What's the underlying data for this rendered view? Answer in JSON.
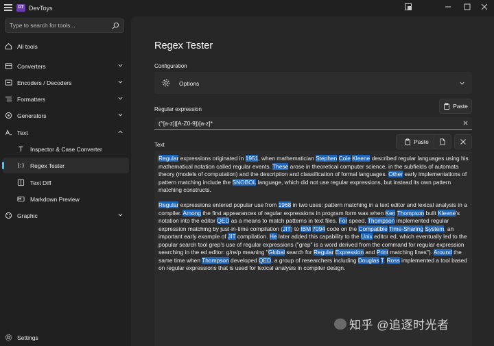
{
  "window": {
    "title": "DevToys",
    "logo": "DevToys"
  },
  "search": {
    "placeholder": "Type to search for tools..."
  },
  "sidebar": {
    "all_tools": "All tools",
    "groups": [
      {
        "label": "Converters",
        "icon": "converters-icon"
      },
      {
        "label": "Encoders / Decoders",
        "icon": "encoders-icon"
      },
      {
        "label": "Formatters",
        "icon": "formatters-icon"
      },
      {
        "label": "Generators",
        "icon": "generators-icon"
      },
      {
        "label": "Text",
        "icon": "text-icon"
      },
      {
        "label": "Graphic",
        "icon": "graphic-icon"
      }
    ],
    "text_items": [
      {
        "label": "Inspector & Case Converter",
        "icon": "inspector-icon"
      },
      {
        "label": "Regex Tester",
        "icon": "regex-icon",
        "selected": true
      },
      {
        "label": "Text Diff",
        "icon": "text-diff-icon"
      },
      {
        "label": "Markdown Preview",
        "icon": "markdown-icon"
      }
    ],
    "settings": "Settings"
  },
  "main": {
    "title": "Regex Tester",
    "configuration_label": "Configuration",
    "options_label": "Options",
    "regex_label": "Regular expression",
    "paste_label": "Paste",
    "regex_value": "(^[a-z]|[A-Z0-9])[a-z]*",
    "text_label": "Text",
    "text_paste_label": "Paste"
  },
  "text_content": {
    "paragraphs": [
      [
        {
          "t": "Regular",
          "h": true
        },
        {
          "t": " expressions originated in "
        },
        {
          "t": "1951",
          "h": true
        },
        {
          "t": ", when mathematician "
        },
        {
          "t": "Stephen",
          "h": true
        },
        {
          "t": " "
        },
        {
          "t": "Cole",
          "h": true
        },
        {
          "t": " "
        },
        {
          "t": "Kleene",
          "h": true
        },
        {
          "t": " described regular languages using his mathematical notation called regular events. "
        },
        {
          "t": "These",
          "h": true
        },
        {
          "t": " arose in theoretical computer science, in the subfields of automata theory (models of computation) and the description and classification of formal languages. "
        },
        {
          "t": "Other",
          "h": true
        },
        {
          "t": " early implementations of pattern matching include the "
        },
        {
          "t": "SNOBOL",
          "h": true
        },
        {
          "t": " language, which did not use regular expressions, but instead its own pattern matching constructs."
        }
      ],
      [
        {
          "t": "Regular",
          "h": true
        },
        {
          "t": " expressions entered popular use from "
        },
        {
          "t": "1968",
          "h": true
        },
        {
          "t": " in two uses: pattern matching in a text editor and lexical analysis in a compiler. "
        },
        {
          "t": "Among",
          "h": true
        },
        {
          "t": " the first appearances of regular expressions in program form was when "
        },
        {
          "t": "Ken",
          "h": true
        },
        {
          "t": " "
        },
        {
          "t": "Thompson",
          "h": true
        },
        {
          "t": " built "
        },
        {
          "t": "Kleene",
          "h": true
        },
        {
          "t": "'s notation into the editor "
        },
        {
          "t": "QED",
          "h": true
        },
        {
          "t": " as a means to match patterns in text files. "
        },
        {
          "t": "For",
          "h": true
        },
        {
          "t": " speed, "
        },
        {
          "t": "Thompson",
          "h": true
        },
        {
          "t": " implemented regular expression matching by just-in-time compilation ("
        },
        {
          "t": "JIT",
          "h": true
        },
        {
          "t": ") to "
        },
        {
          "t": "IBM",
          "h": true
        },
        {
          "t": " "
        },
        {
          "t": "7094",
          "h": true
        },
        {
          "t": " code on the "
        },
        {
          "t": "Compatible",
          "h": true
        },
        {
          "t": " "
        },
        {
          "t": "Time-Sharing",
          "h": true
        },
        {
          "t": " "
        },
        {
          "t": "System",
          "h": true
        },
        {
          "t": ", an important early example of "
        },
        {
          "t": "JIT",
          "h": true
        },
        {
          "t": " compilation. "
        },
        {
          "t": "He",
          "h": true
        },
        {
          "t": " later added this capability to the "
        },
        {
          "t": "Unix",
          "h": true
        },
        {
          "t": " editor ed, which eventually led to the popular search tool grep's use of regular expressions (\"grep\" is a word derived from the command for regular expression searching in the ed editor: g/re/p meaning \""
        },
        {
          "t": "Global",
          "h": true
        },
        {
          "t": " search for "
        },
        {
          "t": "Regular",
          "h": true
        },
        {
          "t": " "
        },
        {
          "t": "Expression",
          "h": true
        },
        {
          "t": " and "
        },
        {
          "t": "Print",
          "h": true
        },
        {
          "t": " matching lines\"). "
        },
        {
          "t": "Around",
          "h": true
        },
        {
          "t": " the same time when "
        },
        {
          "t": "Thompson",
          "h": true
        },
        {
          "t": " developed "
        },
        {
          "t": "QED",
          "h": true
        },
        {
          "t": ", a group of researchers including "
        },
        {
          "t": "Douglas",
          "h": true
        },
        {
          "t": " "
        },
        {
          "t": "T",
          "h": true
        },
        {
          "t": ". "
        },
        {
          "t": "Ross",
          "h": true
        },
        {
          "t": " implemented a tool based on regular expressions that is used for lexical analysis in compiler design."
        }
      ]
    ]
  },
  "watermark": "知乎 @追逐时光者",
  "colors": {
    "accent": "#4cc2ff",
    "highlight": "#1f63b5",
    "background": "#202020",
    "panel": "#272727"
  }
}
